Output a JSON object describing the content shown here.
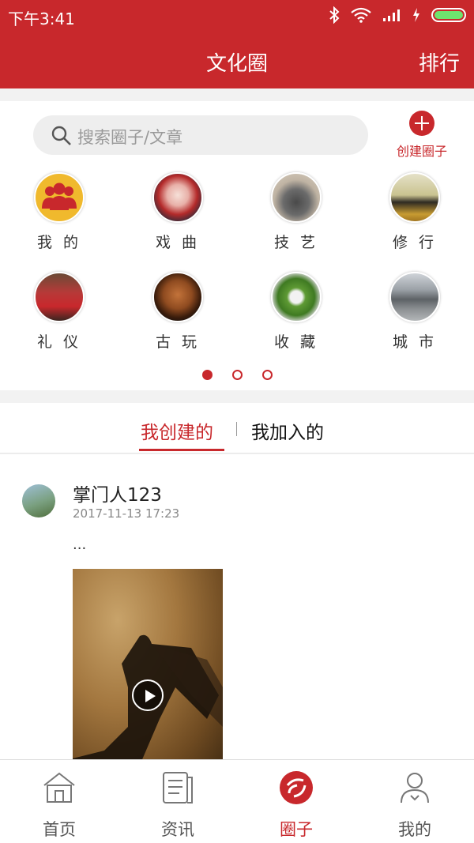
{
  "status_bar": {
    "time": "下午3:41"
  },
  "nav": {
    "title": "文化圈",
    "right_action": "排行"
  },
  "search": {
    "placeholder": "搜索圈子/文章"
  },
  "create_circle": {
    "label": "创建圈子"
  },
  "categories": [
    {
      "name": "我 的",
      "icon": "group-icon"
    },
    {
      "name": "戏 曲",
      "icon": "opera-mask-icon"
    },
    {
      "name": "技 艺",
      "icon": "pottery-icon"
    },
    {
      "name": "修 行",
      "icon": "meditation-icon"
    },
    {
      "name": "礼 仪",
      "icon": "qipao-icon"
    },
    {
      "name": "古 玩",
      "icon": "walnut-carving-icon"
    },
    {
      "name": "收 藏",
      "icon": "jade-ring-icon"
    },
    {
      "name": "城 市",
      "icon": "city-gate-icon"
    }
  ],
  "pager": {
    "count": 3,
    "active_index": 0
  },
  "tabs": {
    "created": "我创建的",
    "joined": "我加入的",
    "active": "created"
  },
  "post": {
    "username": "掌门人123",
    "date": "2017-11-13 17:23",
    "excerpt": "..."
  },
  "bottom_nav": [
    {
      "label": "首页",
      "icon": "home-icon"
    },
    {
      "label": "资讯",
      "icon": "news-icon"
    },
    {
      "label": "圈子",
      "icon": "circle-icon",
      "active": true
    },
    {
      "label": "我的",
      "icon": "profile-icon"
    }
  ],
  "colors": {
    "brand": "#c8282c"
  }
}
